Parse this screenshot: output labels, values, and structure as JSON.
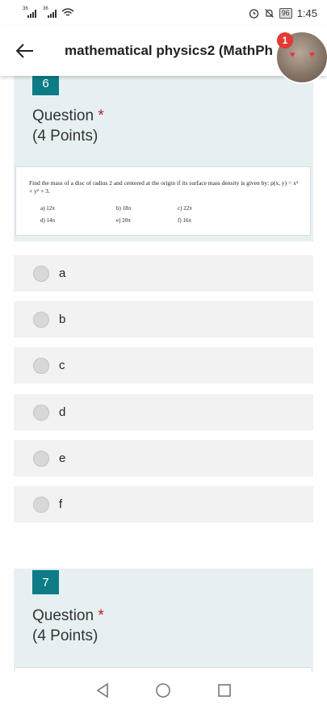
{
  "status": {
    "net1": "36",
    "net2": "36",
    "battery": "96",
    "time": "1:45"
  },
  "header": {
    "title": "mathematical physics2 (MathPh",
    "badge_count": "1"
  },
  "question6": {
    "number": "6",
    "title": "Question",
    "required_mark": "*",
    "points": "(4 Points)",
    "image": {
      "problem": "Find the mass of a disc of radius 2 and centered at the origin if its surface mass density is given by: ρ(x, y) = x² + y² + 3.",
      "choices": [
        "a)  12π",
        "b) 18π",
        "c) 22π",
        "d)  14π",
        "e) 20π",
        "f) 16π"
      ]
    },
    "options": [
      "a",
      "b",
      "c",
      "d",
      "e",
      "f"
    ]
  },
  "question7": {
    "number": "7",
    "title": "Question",
    "required_mark": "*",
    "points": "(4 Points)"
  },
  "colors": {
    "accent": "#0e7c86",
    "card_bg": "#e6eff2",
    "option_bg": "#f2f2f2",
    "required": "#b71c1c",
    "badge": "#e53935"
  },
  "icons": {
    "back": "arrow-left-icon",
    "nav": [
      "back-triangle-icon",
      "home-circle-icon",
      "recents-square-icon"
    ]
  }
}
